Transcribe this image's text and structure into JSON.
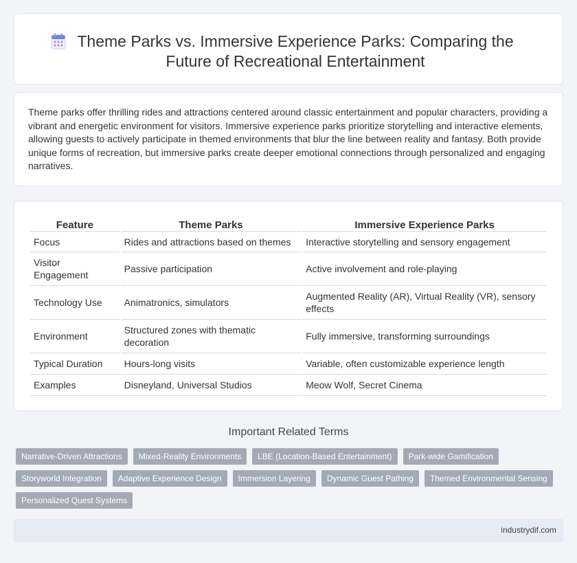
{
  "header": {
    "icon": "calendar-icon",
    "title": "Theme Parks vs. Immersive Experience Parks: Comparing the Future of Recreational Entertainment"
  },
  "intro": "Theme parks offer thrilling rides and attractions centered around classic entertainment and popular characters, providing a vibrant and energetic environment for visitors. Immersive experience parks prioritize storytelling and interactive elements, allowing guests to actively participate in themed environments that blur the line between reality and fantasy. Both provide unique forms of recreation, but immersive parks create deeper emotional connections through personalized and engaging narratives.",
  "table": {
    "headers": [
      "Feature",
      "Theme Parks",
      "Immersive Experience Parks"
    ],
    "rows": [
      [
        "Focus",
        "Rides and attractions based on themes",
        "Interactive storytelling and sensory engagement"
      ],
      [
        "Visitor Engagement",
        "Passive participation",
        "Active involvement and role-playing"
      ],
      [
        "Technology Use",
        "Animatronics, simulators",
        "Augmented Reality (AR), Virtual Reality (VR), sensory effects"
      ],
      [
        "Environment",
        "Structured zones with thematic decoration",
        "Fully immersive, transforming surroundings"
      ],
      [
        "Typical Duration",
        "Hours-long visits",
        "Variable, often customizable experience length"
      ],
      [
        "Examples",
        "Disneyland, Universal Studios",
        "Meow Wolf, Secret Cinema"
      ]
    ]
  },
  "related": {
    "title": "Important Related Terms",
    "tags": [
      "Narrative-Driven Attractions",
      "Mixed-Reality Environments",
      "LBE (Location-Based Entertainment)",
      "Park-wide Gamification",
      "Storyworld Integration",
      "Adaptive Experience Design",
      "Immersion Layering",
      "Dynamic Guest Pathing",
      "Themed Environmental Sensing",
      "Personalized Quest Systems"
    ]
  },
  "footer": {
    "site": "industrydif.com"
  },
  "colors": {
    "tag_bg": "#a3aab5",
    "page_bg": "#f3f4f8",
    "footer_bg": "#e6eaf4",
    "icon_accent": "#6f86e0"
  }
}
